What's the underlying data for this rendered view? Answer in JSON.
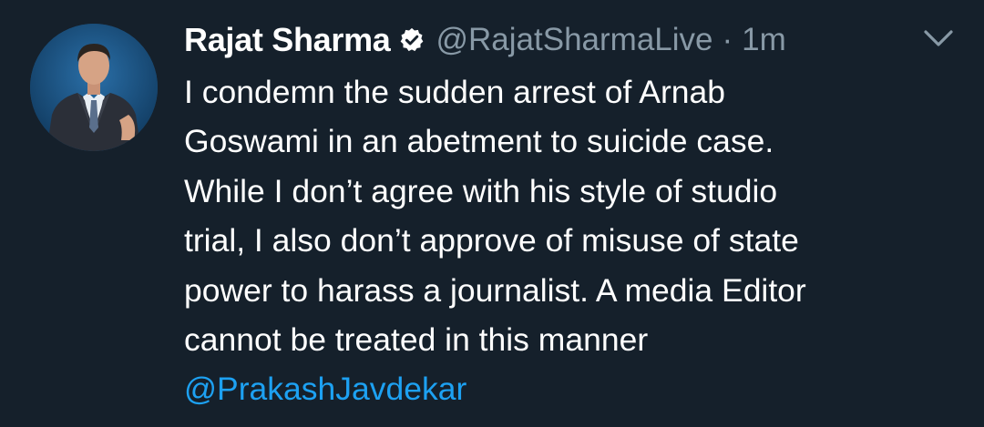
{
  "tweet": {
    "author_name": "Rajat Sharma",
    "author_handle": "@RajatSharmaLive",
    "separator": "·",
    "timestamp": "1m",
    "verified": true,
    "body_lines": [
      "I condemn the sudden arrest of Arnab",
      "Goswami in an abetment to suicide case.",
      "While I don’t agree with his style of studio",
      "trial, I also don’t approve of misuse of state",
      "power to harass a journalist. A media Editor",
      "cannot be treated in this manner"
    ],
    "mention": "@PrakashJavdekar",
    "icons": {
      "verified": "verified-badge-icon",
      "menu": "chevron-down-icon"
    }
  },
  "colors": {
    "background": "#15202b",
    "text": "#ffffff",
    "muted": "#8899a6",
    "link": "#1da1f2"
  }
}
